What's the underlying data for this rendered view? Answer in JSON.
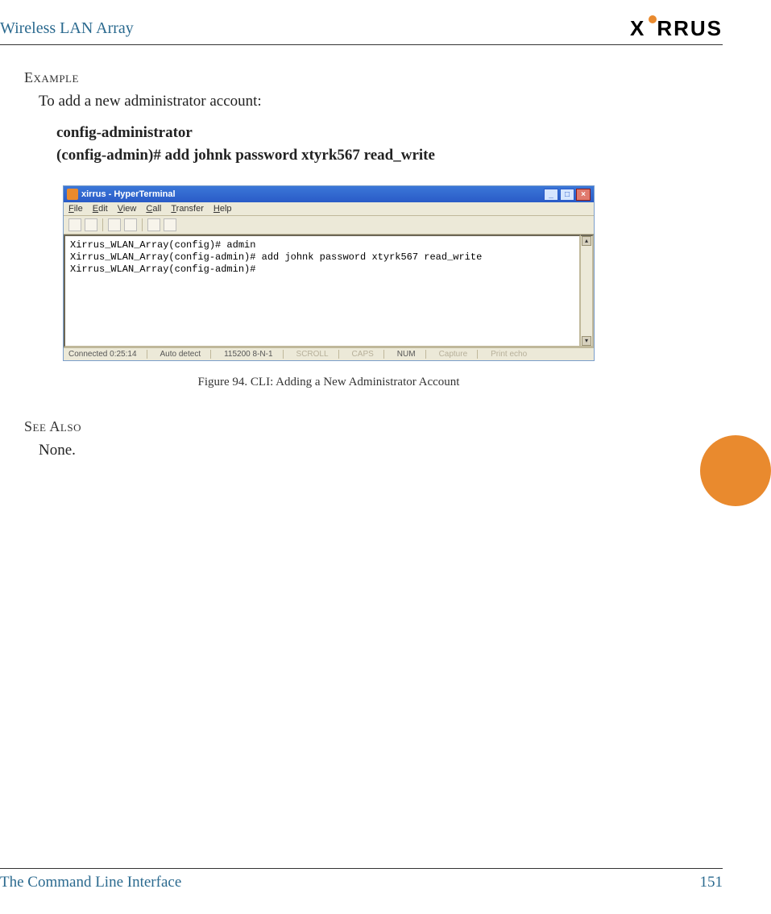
{
  "header": {
    "title": "Wireless LAN Array",
    "logo_text": "X RRUS"
  },
  "sections": {
    "example_label": "Example",
    "intro": "To add a new administrator account:",
    "cmd1": "config-administrator",
    "cmd2": "(config-admin)# add johnk password xtyrk567 read_write",
    "see_also_label": "See Also",
    "see_also_body": "None."
  },
  "terminal": {
    "title": "xirrus - HyperTerminal",
    "menu": [
      "File",
      "Edit",
      "View",
      "Call",
      "Transfer",
      "Help"
    ],
    "body": "Xirrus_WLAN_Array(config)# admin\nXirrus_WLAN_Array(config-admin)# add johnk password xtyrk567 read_write\nXirrus_WLAN_Array(config-admin)#",
    "status": {
      "connected": "Connected 0:25:14",
      "detect": "Auto detect",
      "baud": "115200 8-N-1",
      "scroll": "SCROLL",
      "caps": "CAPS",
      "num": "NUM",
      "capture": "Capture",
      "printecho": "Print echo"
    }
  },
  "figure_caption": "Figure 94. CLI: Adding a New Administrator Account",
  "footer": {
    "section": "The Command Line Interface",
    "page": "151"
  }
}
